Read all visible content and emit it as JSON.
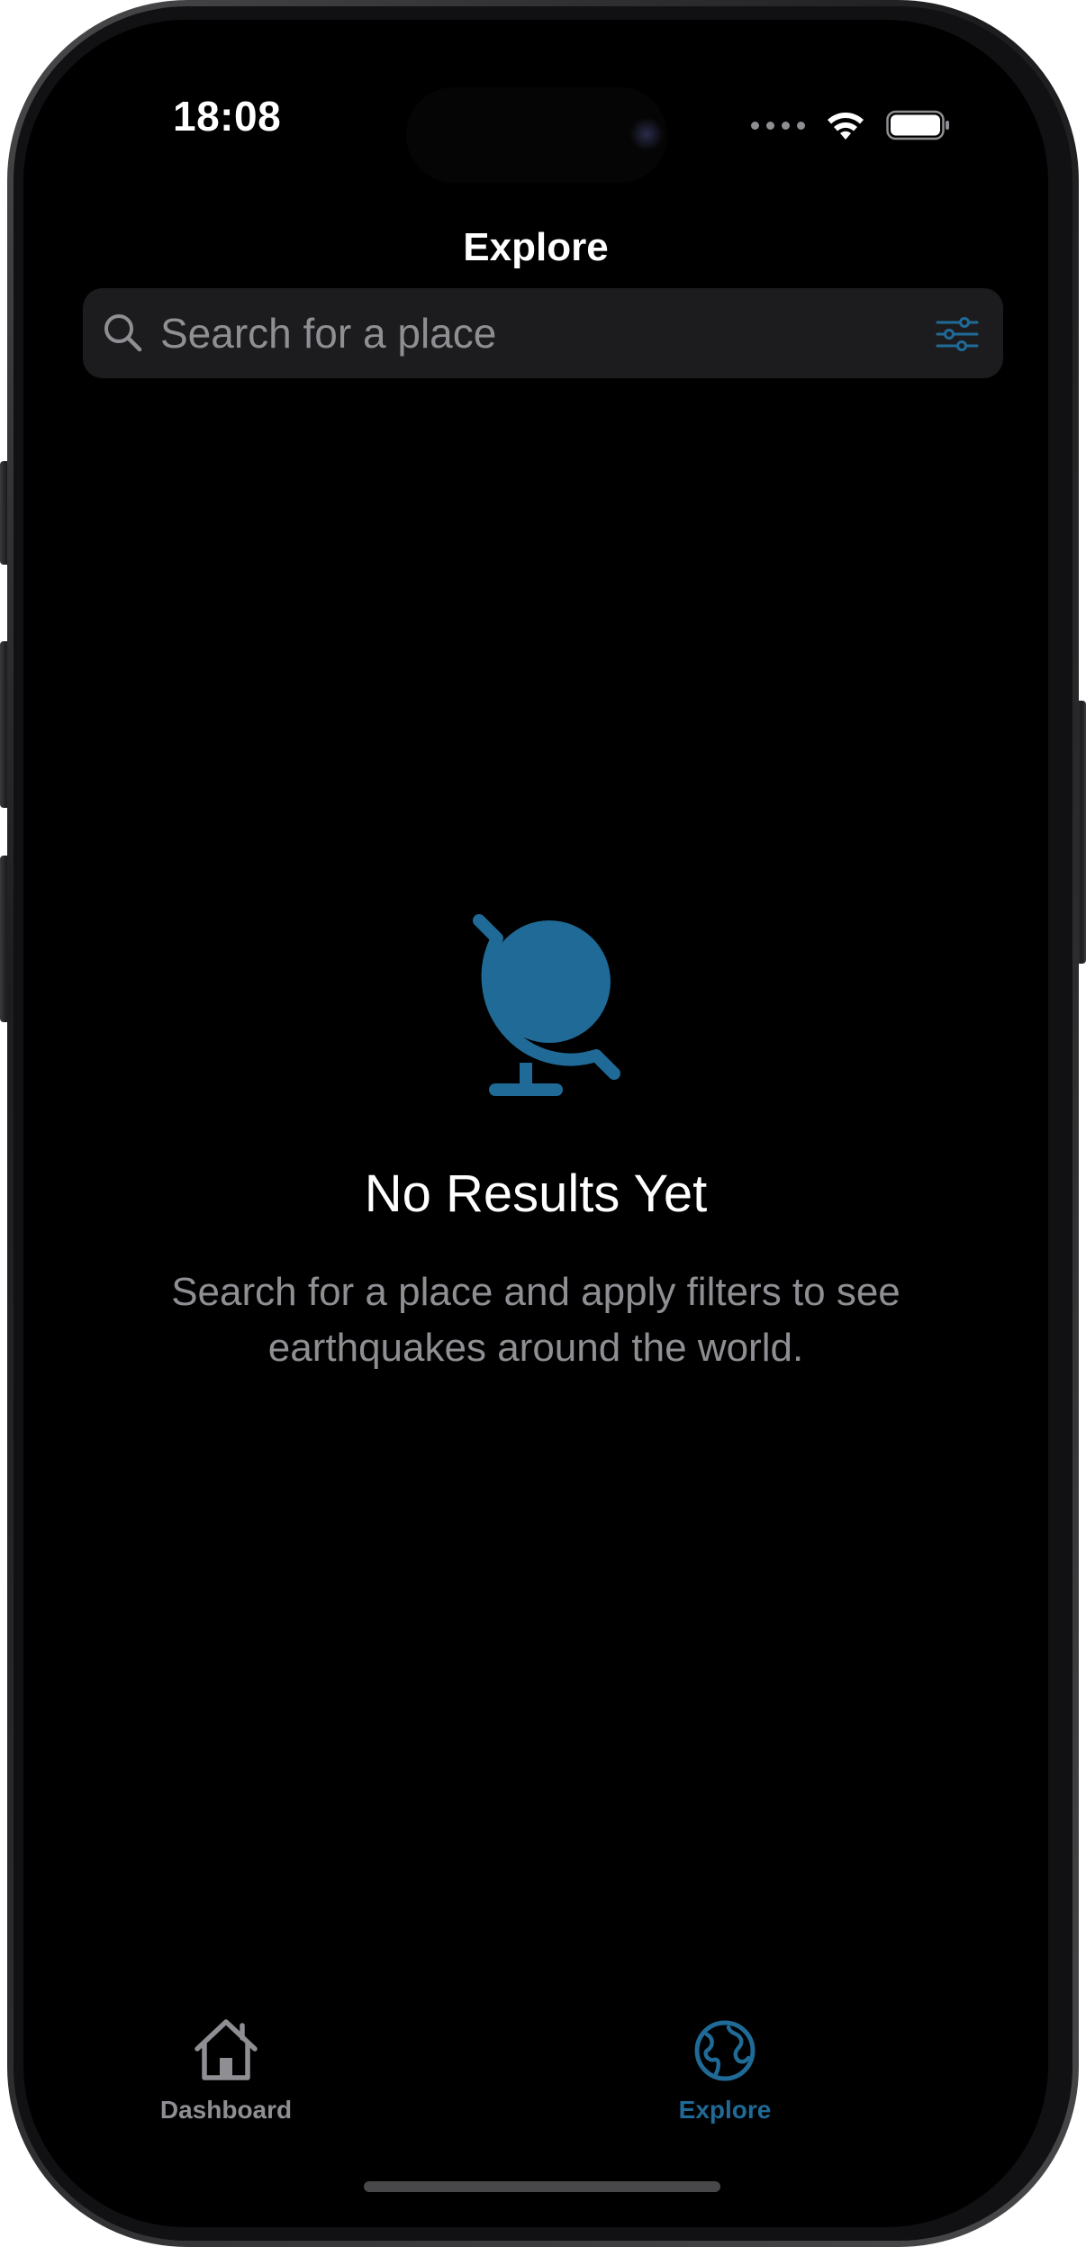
{
  "status_bar": {
    "time": "18:08"
  },
  "nav": {
    "title": "Explore"
  },
  "search": {
    "placeholder": "Search for a place",
    "icon": "magnifyingglass-icon",
    "filter_icon": "slider-horizontal-icon"
  },
  "empty_state": {
    "icon": "globe-stand-icon",
    "title": "No Results Yet",
    "message": "Search for a place and apply filters to see earthquakes around the world."
  },
  "tab_bar": {
    "items": [
      {
        "label": "Dashboard",
        "icon": "house-icon",
        "selected": false
      },
      {
        "label": "Explore",
        "icon": "globe-icon",
        "selected": true
      }
    ]
  },
  "colors": {
    "background": "#000000",
    "accent": "#1f6a96",
    "search_field": "#1c1c1e",
    "secondary_text": "#8e8e93",
    "inactive_tab": "#8e8e93"
  }
}
